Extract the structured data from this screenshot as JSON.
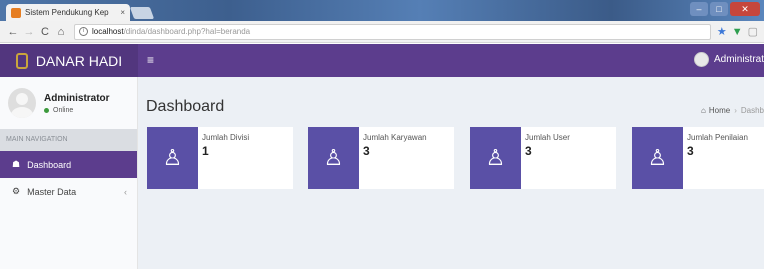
{
  "browser": {
    "tab_title": "Sistem Pendukung Kep",
    "tab_close": "×",
    "url_host": "localhost",
    "url_path": "/dinda/dashboard.php?hal=beranda",
    "info_glyph": "i",
    "star_glyph": "★",
    "nav_back": "←",
    "nav_forward": "→",
    "nav_reload": "C",
    "nav_home": "⌂",
    "win_min": "–",
    "win_max": "□",
    "win_close": "✕"
  },
  "app": {
    "brand": "DANAR HADI",
    "menu_glyph": "≡",
    "account_label": "Administrat"
  },
  "sidebar": {
    "user_name": "Administrator",
    "user_status": "Online",
    "nav_header": "MAIN NAVIGATION",
    "items": [
      {
        "label": "Dashboard",
        "icon": "dashboard-icon",
        "glyph": "☗"
      },
      {
        "label": "Master Data",
        "icon": "gear-icon",
        "glyph": "⚙",
        "caret": "‹"
      }
    ]
  },
  "main": {
    "page_title": "Dashboard",
    "breadcrumb": {
      "home_glyph": "⌂",
      "home": "Home",
      "sep": "›",
      "current": "Dashb"
    },
    "cards": [
      {
        "label": "Jumlah Divisi",
        "value": "1",
        "icon": "user-icon",
        "glyph": "♙"
      },
      {
        "label": "Jumlah Karyawan",
        "value": "3",
        "icon": "user-icon",
        "glyph": "♙"
      },
      {
        "label": "Jumlah User",
        "value": "3",
        "icon": "user-icon",
        "glyph": "♙"
      },
      {
        "label": "Jumlah Penilaian",
        "value": "3",
        "icon": "user-icon",
        "glyph": "♙"
      }
    ]
  },
  "colors": {
    "primary": "#5c3d8d",
    "logo_bg": "#52367e",
    "card_icon_bg": "#5a50a6",
    "content_bg": "#ecf0f5"
  }
}
